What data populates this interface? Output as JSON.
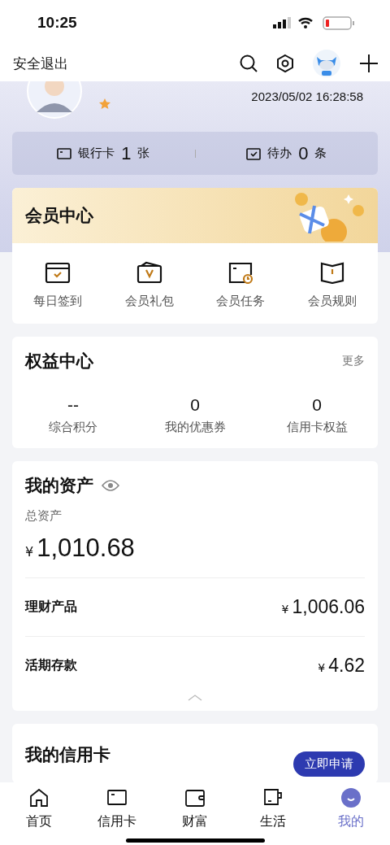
{
  "status_bar": {
    "time": "10:25"
  },
  "nav": {
    "logout": "安全退出"
  },
  "profile": {
    "timestamp": "2023/05/02 16:28:58"
  },
  "summary": [
    {
      "kind": "card",
      "label": "银行卡",
      "count": "1",
      "unit": "张"
    },
    {
      "kind": "todo",
      "label": "待办",
      "count": "0",
      "unit": "条"
    }
  ],
  "member_center": {
    "title": "会员中心",
    "items": [
      {
        "kind": "checkin",
        "label": "每日签到"
      },
      {
        "kind": "gift",
        "label": "会员礼包"
      },
      {
        "kind": "task",
        "label": "会员任务"
      },
      {
        "kind": "rules",
        "label": "会员规则"
      }
    ]
  },
  "benefits": {
    "title": "权益中心",
    "more": "更多",
    "stats": [
      {
        "value": "--",
        "label": "综合积分"
      },
      {
        "value": "0",
        "label": "我的优惠券"
      },
      {
        "value": "0",
        "label": "信用卡权益"
      }
    ]
  },
  "assets": {
    "title": "我的资产",
    "total_label": "总资产",
    "currency": "¥",
    "total": "1,010.68",
    "rows": [
      {
        "label": "理财产品",
        "currency": "¥",
        "amount": "1,006.06"
      },
      {
        "label": "活期存款",
        "currency": "¥",
        "amount": "4.62"
      }
    ]
  },
  "credit_card": {
    "title": "我的信用卡",
    "button": "立即申请"
  },
  "tabs": [
    {
      "kind": "home",
      "label": "首页",
      "selected": false
    },
    {
      "kind": "card",
      "label": "信用卡",
      "selected": false
    },
    {
      "kind": "wallet",
      "label": "财富",
      "selected": false
    },
    {
      "kind": "cup",
      "label": "生活",
      "selected": false
    },
    {
      "kind": "me",
      "label": "我的",
      "selected": true
    }
  ]
}
